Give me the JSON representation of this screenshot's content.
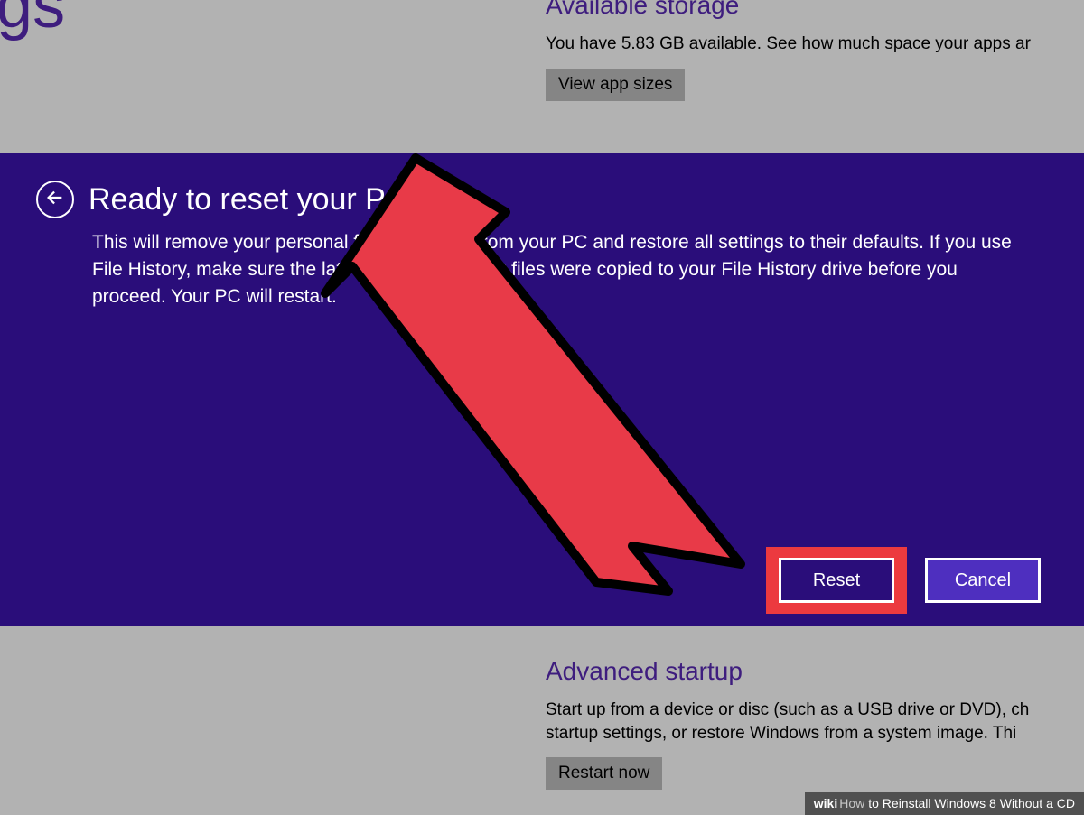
{
  "background": {
    "page_title_partial": "ings",
    "storage": {
      "heading": "Available storage",
      "description": "You have 5.83 GB available. See how much space your apps ar",
      "button": "View app sizes"
    },
    "startup": {
      "heading": "Advanced startup",
      "description": "Start up from a device or disc (such as a USB drive or DVD), ch  startup settings, or restore Windows from a system image. Thi",
      "button": "Restart now"
    }
  },
  "modal": {
    "title": "Ready to reset your PC",
    "body": "This will remove your personal files and apps from your PC and restore all settings to their defaults. If you use File History, make sure the latest versions of your files were copied to your File History drive before you proceed. Your PC will restart.",
    "reset_label": "Reset",
    "cancel_label": "Cancel"
  },
  "caption": {
    "brand_bold": "wiki",
    "brand_light": "How",
    "text": " to Reinstall Windows 8 Without a CD"
  }
}
